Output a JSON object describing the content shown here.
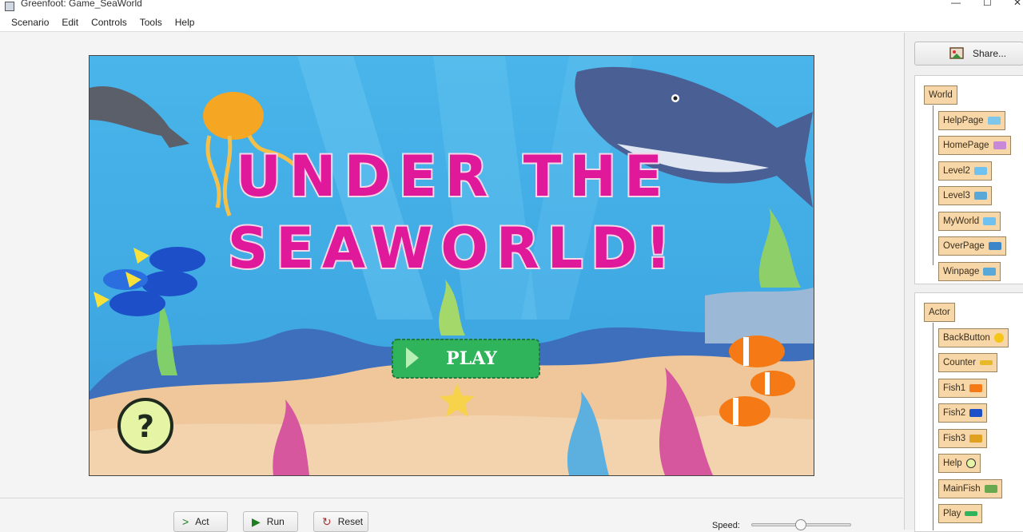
{
  "window": {
    "title": "Greenfoot: Game_SeaWorld"
  },
  "menu": [
    "Scenario",
    "Edit",
    "Controls",
    "Tools",
    "Help"
  ],
  "world": {
    "title_line1": "UNDER THE",
    "title_line2": "SEAWORLD!",
    "play_label": "PLAY",
    "help_symbol": "?"
  },
  "sidebar": {
    "share_label": "Share...",
    "world_root": "World",
    "world_classes": [
      "HelpPage",
      "HomePage",
      "Level2",
      "Level3",
      "MyWorld",
      "OverPage",
      "Winpage"
    ],
    "actor_root": "Actor",
    "actor_classes": [
      "BackButton",
      "Counter",
      "Fish1",
      "Fish2",
      "Fish3",
      "Help",
      "MainFish",
      "Play"
    ]
  },
  "controls": {
    "act_label": "Act",
    "run_label": "Run",
    "reset_label": "Reset",
    "speed_label": "Speed:"
  },
  "colors": {
    "class_bg": "#f7d6a8",
    "title_pink": "#e0199a",
    "play_green": "#2fb35b"
  }
}
